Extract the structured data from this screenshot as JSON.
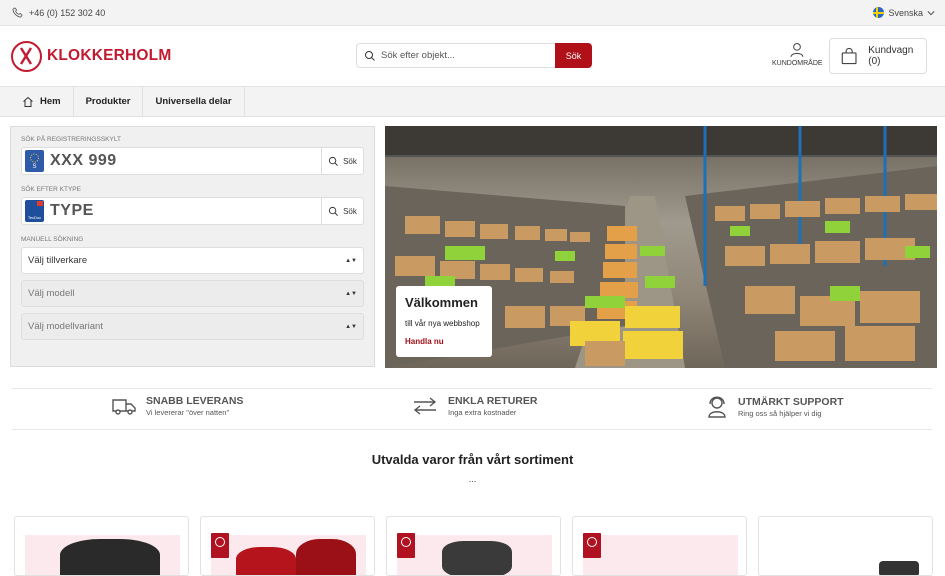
{
  "topbar": {
    "phone": "+46 (0) 152 302 40",
    "language": "Svenska"
  },
  "header": {
    "brand": "KLOKKERHOLM",
    "search_placeholder": "Sök efter objekt...",
    "search_button": "Sök",
    "account_label": "KUNDOMRÅDE",
    "cart_label": "Kundvagn (0)"
  },
  "nav": {
    "items": [
      {
        "label": "Hem"
      },
      {
        "label": "Produkter"
      },
      {
        "label": "Universella delar"
      }
    ]
  },
  "vehicle_search": {
    "reg_label": "SÖK PÅ REGISTRERINGSSKYLT",
    "reg_placeholder": "XXX 999",
    "reg_badge": "S",
    "reg_button": "Sök",
    "ktype_label": "SÖK EFTER KTYPE",
    "ktype_placeholder": "TYPE",
    "ktype_badge": "TecDoc",
    "ktype_button": "Sök",
    "manual_label": "MANUELL SÖKNING",
    "selects": [
      "Välj tillverkare",
      "Välj modell",
      "Välj modellvariant"
    ]
  },
  "hero": {
    "title": "Välkommen",
    "text": "till vår nya webbshop",
    "link": "Handla nu"
  },
  "features": [
    {
      "title": "SNABB LEVERANS",
      "subtitle": "Vi levererar \"över natten\"",
      "icon": "truck-icon"
    },
    {
      "title": "ENKLA RETURER",
      "subtitle": "Inga extra kostnader",
      "icon": "return-arrows-icon"
    },
    {
      "title": "UTMÄRKT SUPPORT",
      "subtitle": "Ring oss så hjälper vi dig",
      "icon": "support-agent-icon"
    }
  ],
  "section": {
    "title": "Utvalda varor från vårt sortiment",
    "dots": "..."
  },
  "colors": {
    "brand": "#c21a30",
    "button": "#b01018",
    "link": "#a01018"
  }
}
